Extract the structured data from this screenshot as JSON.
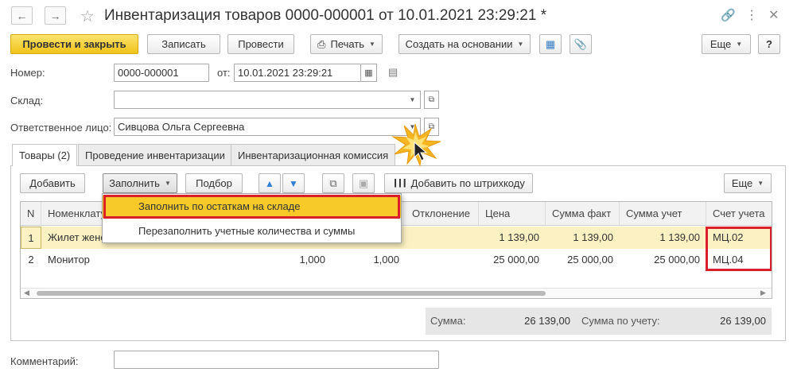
{
  "window": {
    "title": "Инвентаризация товаров 0000-000001 от 10.01.2021 23:29:21 *"
  },
  "toolbar": {
    "post_close": "Провести и закрыть",
    "save": "Записать",
    "post": "Провести",
    "print": "Печать",
    "create_based": "Создать на основании",
    "more": "Еще",
    "help": "?"
  },
  "header": {
    "number_label": "Номер:",
    "number_value": "0000-000001",
    "date_label": "от:",
    "date_value": "10.01.2021 23:29:21",
    "warehouse_label": "Склад:",
    "warehouse_value": "",
    "responsible_label": "Ответственное лицо:",
    "responsible_value": "Сивцова Ольга Сергеевна"
  },
  "tabs": [
    {
      "label": "Товары (2)",
      "active": true
    },
    {
      "label": "Проведение инвентаризации",
      "active": false
    },
    {
      "label": "Инвентаризационная комиссия",
      "active": false
    }
  ],
  "table_toolbar": {
    "add": "Добавить",
    "fill": "Заполнить",
    "pick": "Подбор",
    "barcode": "Добавить по штрихкоду",
    "more": "Еще"
  },
  "fill_menu": {
    "items": [
      "Заполнить по остаткам на складе",
      "Перезаполнить учетные количества и суммы"
    ]
  },
  "table": {
    "columns": [
      "N",
      "Номенклатура",
      "Отклонение",
      "Цена",
      "Сумма факт",
      "Сумма учет",
      "Счет учета"
    ],
    "rows": [
      {
        "n": "1",
        "name": "Жилет жено",
        "qty_fact": "",
        "qty_acc": "",
        "deviation": "",
        "price": "1 139,00",
        "sum_fact": "1 139,00",
        "sum_acc": "1 139,00",
        "account": "МЦ.02"
      },
      {
        "n": "2",
        "name": "Монитор",
        "qty_fact": "1,000",
        "qty_acc": "1,000",
        "deviation": "",
        "price": "25 000,00",
        "sum_fact": "25 000,00",
        "sum_acc": "25 000,00",
        "account": "МЦ.04"
      }
    ]
  },
  "totals": {
    "sum_label": "Сумма:",
    "sum_value": "26 139,00",
    "sum_acc_label": "Сумма по учету:",
    "sum_acc_value": "26 139,00"
  },
  "comment": {
    "label": "Комментарий:",
    "value": ""
  },
  "colors": {
    "primary_button": "#f1c419",
    "selected_row": "#fbf1c2",
    "highlight_frame": "#d9202a"
  }
}
